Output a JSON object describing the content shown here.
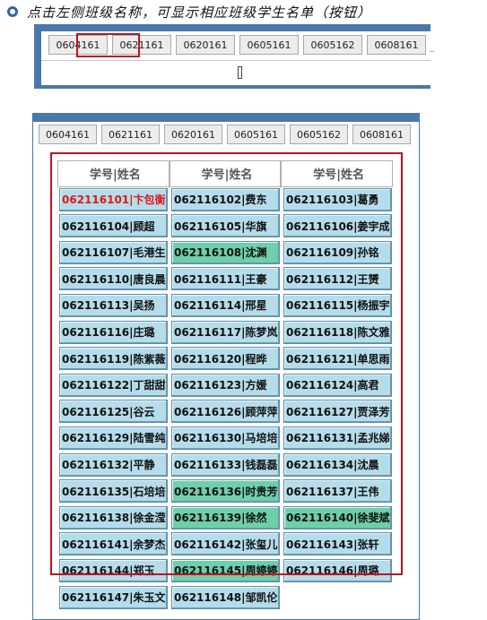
{
  "heading": "点击左侧班级名称，可显示相应班级学生名单（按钮）",
  "classes": [
    "0604161",
    "0621161",
    "0620161",
    "0605161",
    "0605162",
    "0608161"
  ],
  "selected_class": "0621161",
  "table": {
    "header": [
      "学号|姓名",
      "学号|姓名",
      "学号|姓名"
    ],
    "rows": [
      [
        {
          "t": "062116101|卞包衡",
          "s": "red"
        },
        {
          "t": "062116102|费东"
        },
        {
          "t": "062116103|葛勇"
        }
      ],
      [
        {
          "t": "062116104|顾超"
        },
        {
          "t": "062116105|华旗"
        },
        {
          "t": "062116106|姜宇成"
        }
      ],
      [
        {
          "t": "062116107|毛港生"
        },
        {
          "t": "062116108|沈渊",
          "s": "green"
        },
        {
          "t": "062116109|孙铭"
        }
      ],
      [
        {
          "t": "062116110|唐良晨"
        },
        {
          "t": "062116111|王豪"
        },
        {
          "t": "062116112|王赟"
        }
      ],
      [
        {
          "t": "062116113|吴扬"
        },
        {
          "t": "062116114|邢星"
        },
        {
          "t": "062116115|杨振宇"
        }
      ],
      [
        {
          "t": "062116116|庄璐"
        },
        {
          "t": "062116117|陈梦岚"
        },
        {
          "t": "062116118|陈文雅"
        }
      ],
      [
        {
          "t": "062116119|陈紫薇"
        },
        {
          "t": "062116120|程晔"
        },
        {
          "t": "062116121|单思雨"
        }
      ],
      [
        {
          "t": "062116122|丁甜甜"
        },
        {
          "t": "062116123|方媛"
        },
        {
          "t": "062116124|高君"
        }
      ],
      [
        {
          "t": "062116125|谷云"
        },
        {
          "t": "062116126|顾萍萍"
        },
        {
          "t": "062116127|贾泽芳"
        }
      ],
      [
        {
          "t": "062116129|陆雪纯"
        },
        {
          "t": "062116130|马培培"
        },
        {
          "t": "062116131|孟兆娣"
        }
      ],
      [
        {
          "t": "062116132|平静"
        },
        {
          "t": "062116133|钱磊磊"
        },
        {
          "t": "062116134|沈晨"
        }
      ],
      [
        {
          "t": "062116135|石培培"
        },
        {
          "t": "062116136|时贵芳",
          "s": "green"
        },
        {
          "t": "062116137|王伟"
        }
      ],
      [
        {
          "t": "062116138|徐金滢"
        },
        {
          "t": "062116139|徐然",
          "s": "green"
        },
        {
          "t": "062116140|徐斐斌",
          "s": "green"
        }
      ],
      [
        {
          "t": "062116141|余梦杰"
        },
        {
          "t": "062116142|张玺儿"
        },
        {
          "t": "062116143|张轩"
        }
      ],
      [
        {
          "t": "062116144|郑玉"
        },
        {
          "t": "062116145|周婷婷",
          "s": "green"
        },
        {
          "t": "062116146|周璐"
        }
      ],
      [
        {
          "t": "062116147|朱玉文"
        },
        {
          "t": "062116148|邹凯伦"
        },
        null
      ]
    ]
  }
}
